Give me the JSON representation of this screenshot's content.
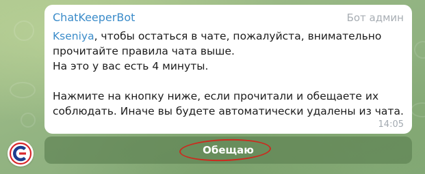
{
  "message": {
    "sender": "ChatKeeperBot",
    "role": "Бот админ",
    "mention": "Kseniya",
    "line1_rest": ", чтобы остаться в чате, пожалуйста, внимательно",
    "line2": "прочитайте правила чата выше.",
    "line3": "На это у вас есть 4 минуты.",
    "line4": "Нажмите на кнопку ниже, если прочитали и обещаете их",
    "line5": "соблюдать. Иначе вы будете автоматически удалены из чата.",
    "time": "14:05"
  },
  "inline_button": {
    "label": "Обещаю"
  },
  "avatar": {
    "icon": "chatkeeper-logo-icon"
  },
  "colors": {
    "sender": "#3a8bc9",
    "annotation_circle": "#cc2a1e",
    "button_bg": "#6b8c5c",
    "chat_background": "#8fb27e"
  }
}
